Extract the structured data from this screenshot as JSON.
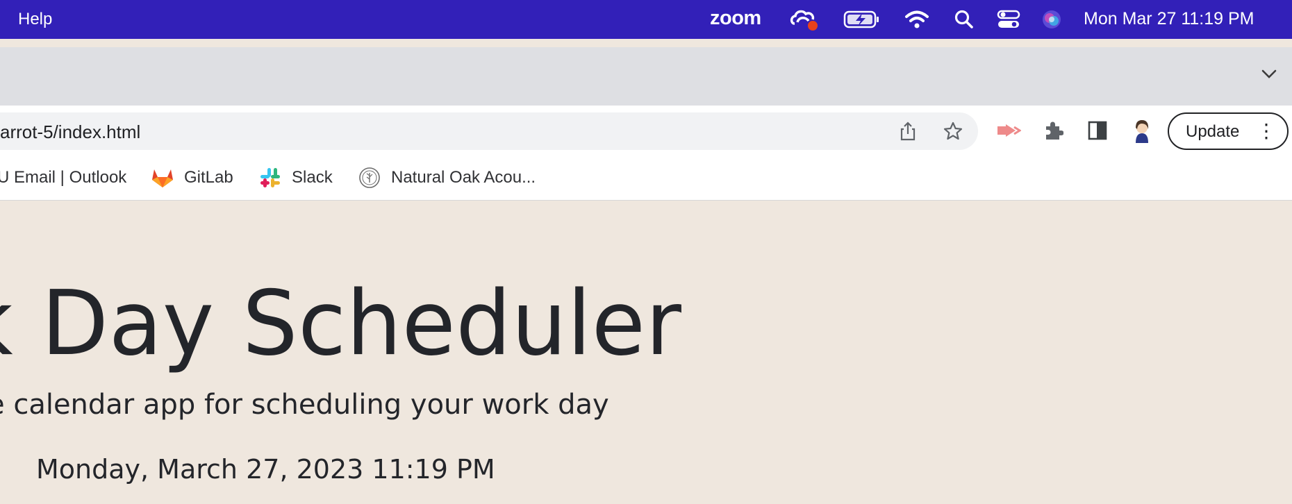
{
  "menubar": {
    "help_label": "Help",
    "zoom_label": "zoom",
    "clock": "Mon Mar 27  11:19 PM",
    "color": "#3220b8"
  },
  "browser": {
    "url": "arrot-5/index.html",
    "update_label": "Update",
    "more_glyph": "⋮",
    "bookmarks": [
      {
        "label": "U Email | Outlook",
        "icon": "none"
      },
      {
        "label": "GitLab",
        "icon": "gitlab-icon"
      },
      {
        "label": "Slack",
        "icon": "slack-icon"
      },
      {
        "label": "Natural Oak Acou...",
        "icon": "natural-oak-icon"
      }
    ]
  },
  "page": {
    "title": "k Day Scheduler",
    "lead": "e calendar app for scheduling your work day",
    "current_day": "Monday, March 27, 2023 11:19 PM",
    "background": "#efe7de"
  }
}
